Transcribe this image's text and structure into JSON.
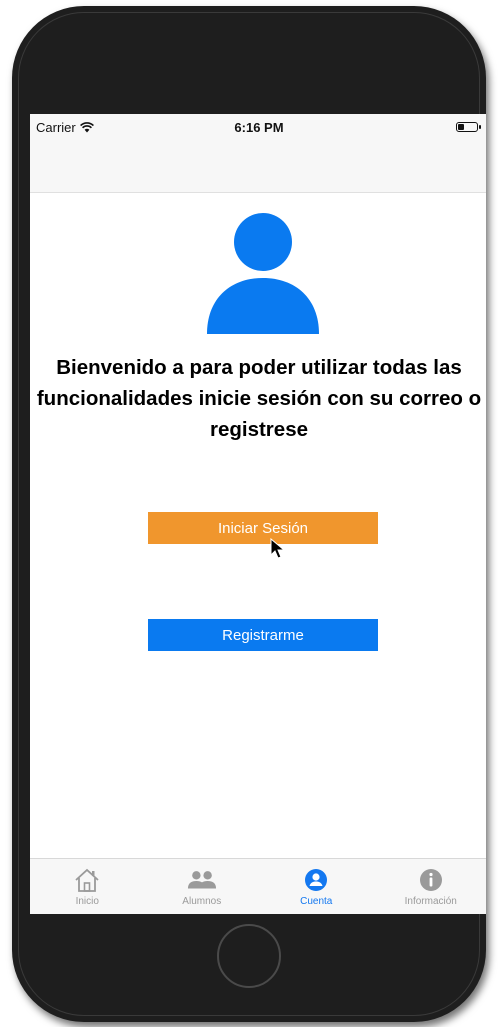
{
  "status_bar": {
    "carrier": "Carrier",
    "time": "6:16 PM",
    "battery_level": 0.35
  },
  "main": {
    "avatar_icon": "user-avatar-icon",
    "welcome_text": "Bienvenido a  para poder utilizar todas las funcionalidades inicie sesión con su correo o registrese",
    "login_button": "Iniciar Sesión",
    "register_button": "Registrarme"
  },
  "tab_bar": {
    "tabs": [
      {
        "label": "Inicio",
        "icon": "home-icon",
        "active": false
      },
      {
        "label": "Alumnos",
        "icon": "people-icon",
        "active": false
      },
      {
        "label": "Cuenta",
        "icon": "account-icon",
        "active": true
      },
      {
        "label": "Información",
        "icon": "info-icon",
        "active": false
      }
    ]
  },
  "colors": {
    "accent_blue": "#1478f0",
    "login_orange": "#f0962d",
    "register_blue": "#0a7af0",
    "tab_inactive": "#9a9a9a"
  }
}
